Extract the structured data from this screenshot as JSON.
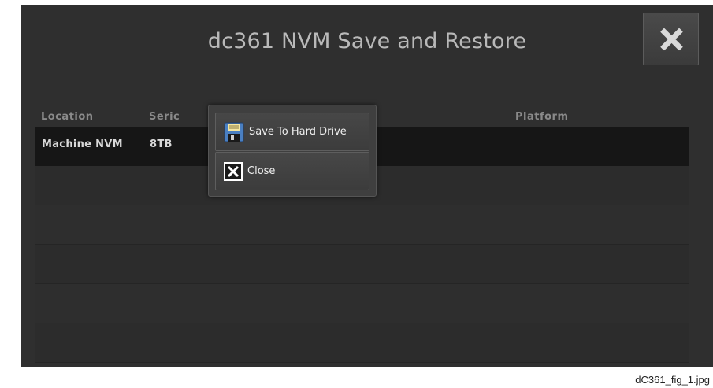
{
  "title": "dc361 NVM Save and Restore",
  "table": {
    "columns": [
      "Location",
      "Seric",
      "Platform"
    ],
    "rows": [
      {
        "location": "Machine NVM",
        "serial": "8TB"
      },
      {},
      {},
      {},
      {},
      {}
    ]
  },
  "popup_menu": {
    "items": [
      {
        "label": "Save To Hard Drive",
        "icon": "floppy-disk-icon"
      },
      {
        "label": "Close",
        "icon": "close-x-icon"
      }
    ]
  },
  "caption": "dC361_fig_1.jpg",
  "colors": {
    "panel_bg": "#2f2f2f",
    "selected_row": "#161616",
    "text": "#d8d8d8"
  }
}
